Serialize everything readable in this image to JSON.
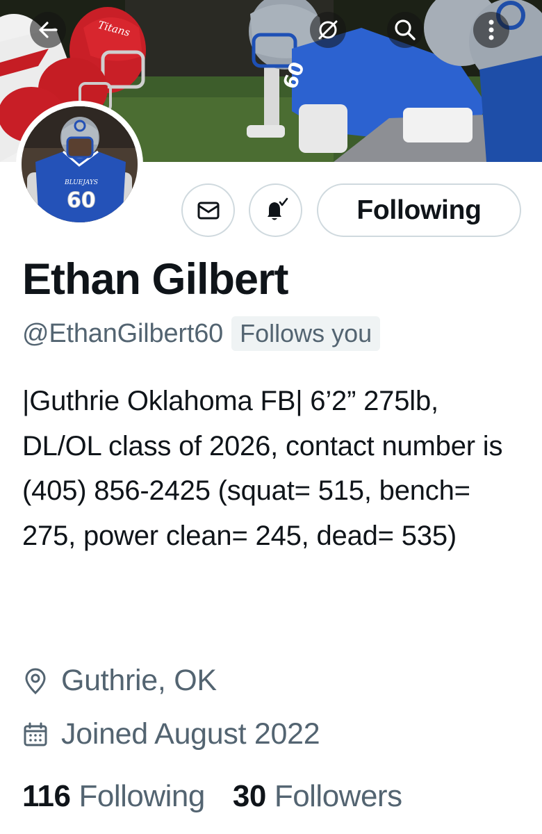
{
  "header": {
    "back_icon": "arrow-left-icon",
    "grok_icon": "slashed-circle-icon",
    "search_icon": "search-icon",
    "more_icon": "more-vertical-icon"
  },
  "banner": {
    "helmet_text_left": "Titans",
    "jersey_number": "60"
  },
  "avatar": {
    "jersey_text": "BLUEJAYS",
    "jersey_number": "60"
  },
  "actions": {
    "message_icon": "envelope-icon",
    "notify_icon": "bell-check-icon",
    "following_label": "Following"
  },
  "profile": {
    "name": "Ethan Gilbert",
    "handle": "@EthanGilbert60",
    "follows_you": "Follows you",
    "bio": "|Guthrie Oklahoma FB| 6’2” 275lb, DL/OL class of 2026, contact number is (405) 856-2425 (squat= 515, bench= 275, power clean= 245, dead= 535)",
    "location": "Guthrie, OK",
    "joined": "Joined August 2022"
  },
  "stats": {
    "following_count": "116",
    "following_label": "Following",
    "followers_count": "30",
    "followers_label": "Followers"
  },
  "colors": {
    "text_primary": "#0f1419",
    "text_secondary": "#536471",
    "border": "#cfd9de",
    "badge_bg": "#eff3f4"
  }
}
